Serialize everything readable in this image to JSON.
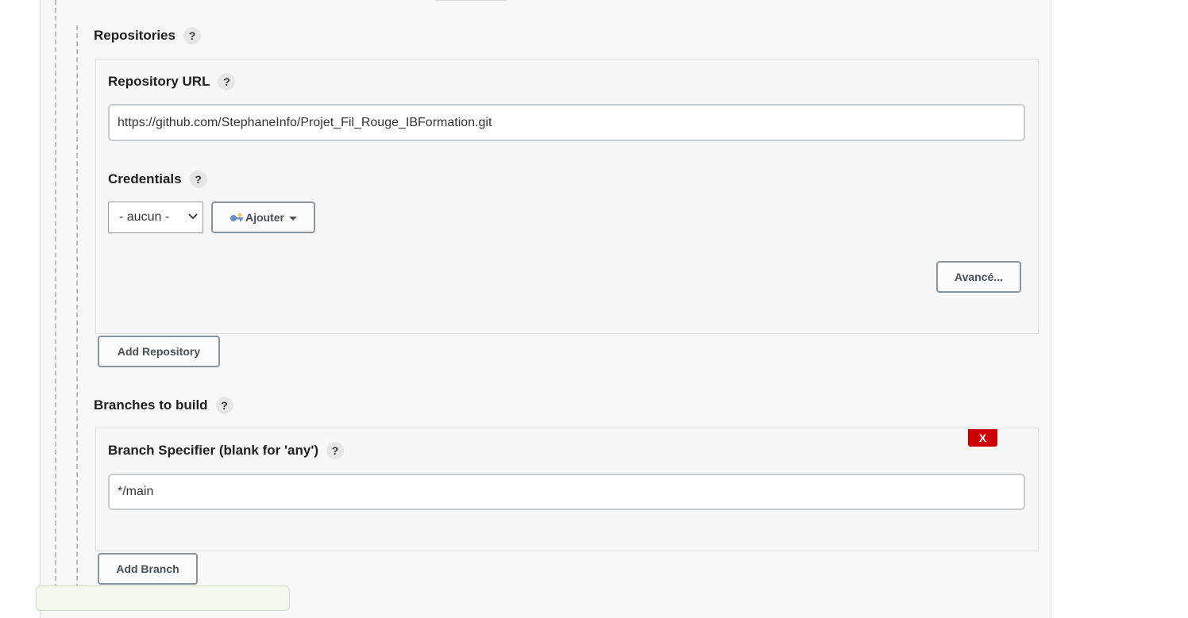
{
  "repositories": {
    "label": "Repositories",
    "help": "?",
    "repository_url": {
      "label": "Repository URL",
      "help": "?",
      "value": "https://github.com/StephaneInfo/Projet_Fil_Rouge_IBFormation.git"
    },
    "credentials": {
      "label": "Credentials",
      "help": "?",
      "selected": "- aucun -",
      "add_button": "Ajouter"
    },
    "advanced_button": "Avancé...",
    "add_repository_button": "Add Repository"
  },
  "branches": {
    "label": "Branches to build",
    "help": "?",
    "delete_button": "X",
    "branch_specifier": {
      "label": "Branch Specifier (blank for 'any')",
      "help": "?",
      "value": "*/main"
    },
    "add_branch_button": "Add Branch"
  },
  "colors": {
    "delete": "#cc0000",
    "panel_bg": "#f8f8f8",
    "border": "#dcdcdc"
  }
}
